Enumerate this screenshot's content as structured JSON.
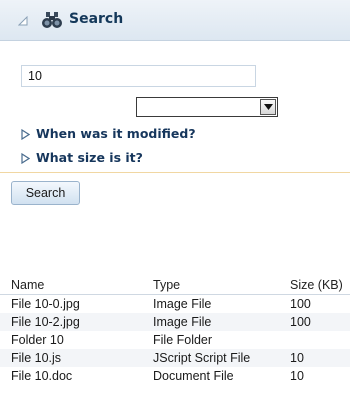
{
  "panel": {
    "title": "Search",
    "colors": {
      "header_bg": "#e4ecf4",
      "title": "#14385a",
      "section_label": "#16365c",
      "divider": "#f1d7a2"
    }
  },
  "search_field": {
    "value": "10",
    "placeholder": ""
  },
  "filter_select": {
    "value": ""
  },
  "sections": [
    {
      "label": "When was it modified?",
      "expanded": false
    },
    {
      "label": "What size is it?",
      "expanded": false
    }
  ],
  "search_button": {
    "label": "Search"
  },
  "results": {
    "columns": [
      "Name",
      "Type",
      "Size (KB)"
    ],
    "rows": [
      {
        "name": "File 10-0.jpg",
        "type": "Image File",
        "size": "100"
      },
      {
        "name": "File 10-2.jpg",
        "type": "Image File",
        "size": "100"
      },
      {
        "name": "Folder 10",
        "type": "File Folder",
        "size": ""
      },
      {
        "name": "File 10.js",
        "type": "JScript Script File",
        "size": "10"
      },
      {
        "name": "File 10.doc",
        "type": "Document File",
        "size": "10"
      }
    ]
  },
  "icons": [
    "collapse-triangle-icon",
    "binoculars-icon",
    "dropdown-arrow-icon",
    "disclosure-triangle-icon"
  ]
}
